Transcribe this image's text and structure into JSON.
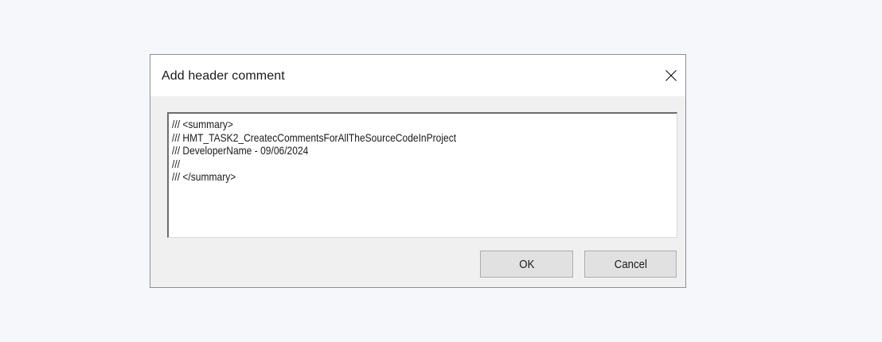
{
  "dialog": {
    "title": "Add header comment",
    "close_icon": "close-icon",
    "editor_text": "/// <summary>\n/// HMT_TASK2_CreatecCommentsForAllTheSourceCodeInProject\n/// DeveloperName - 09/06/2024\n///\n/// </summary>",
    "ok_label": "OK",
    "cancel_label": "Cancel"
  }
}
